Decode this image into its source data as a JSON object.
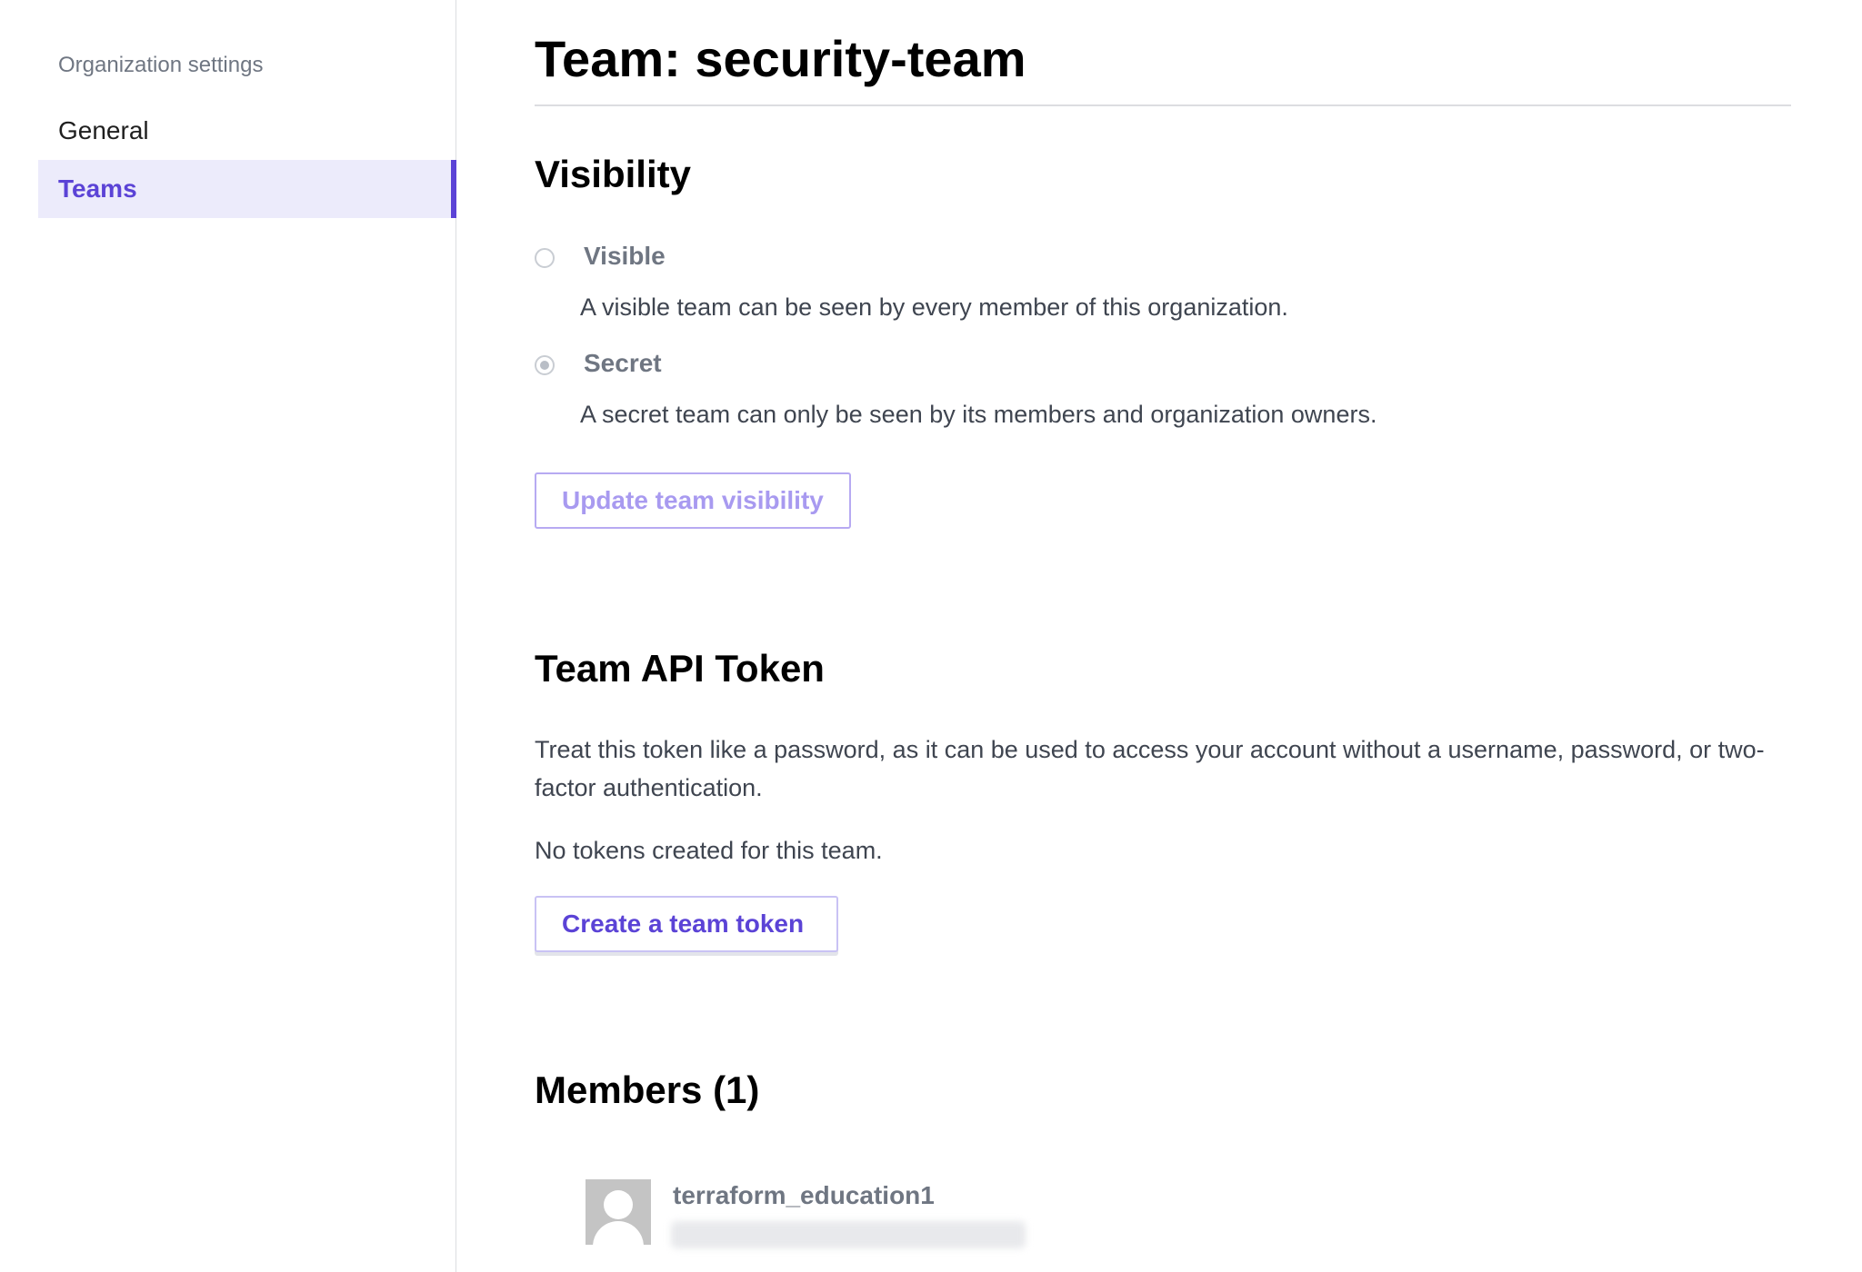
{
  "sidebar": {
    "heading": "Organization settings",
    "items": [
      {
        "label": "General"
      },
      {
        "label": "Teams"
      }
    ]
  },
  "page": {
    "title": "Team: security-team"
  },
  "visibility": {
    "heading": "Visibility",
    "options": [
      {
        "label": "Visible",
        "description": "A visible team can be seen by every member of this organization.",
        "selected": false
      },
      {
        "label": "Secret",
        "description": "A secret team can only be seen by its members and organization owners.",
        "selected": true
      }
    ],
    "update_button": "Update team visibility"
  },
  "token": {
    "heading": "Team API Token",
    "description": "Treat this token like a password, as it can be used to access your account without a username, password, or two-factor authentication.",
    "empty_state": "No tokens created for this team.",
    "create_button": "Create a team token"
  },
  "members": {
    "heading": "Members (1)",
    "list": [
      {
        "username": "terraform_education1"
      }
    ]
  },
  "colors": {
    "accent": "#5b43d6",
    "accent_light": "#ecebfb",
    "muted_text": "#6f7682",
    "border": "#dcdde1"
  }
}
